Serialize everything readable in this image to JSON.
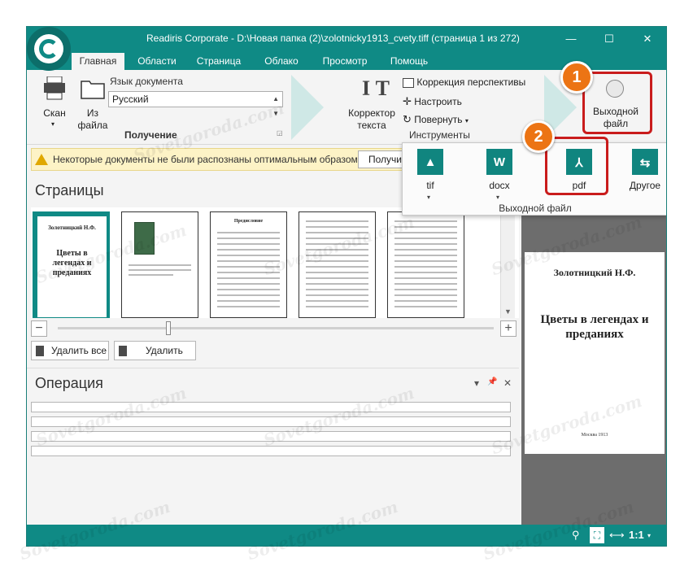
{
  "window": {
    "title": "Readiris Corporate - D:\\Новая папка (2)\\zolotnicky1913_cvety.tiff (страница 1 из 272)",
    "controls": {
      "minimize": "—",
      "maximize": "☐",
      "close": "✕"
    }
  },
  "tabs": [
    "Главная",
    "Области",
    "Страница",
    "Облако",
    "Просмотр",
    "Помощь"
  ],
  "ribbon": {
    "scan_label": "Скан",
    "from_file_label_1": "Из",
    "from_file_label_2": "файла",
    "doc_lang_label": "Язык документа",
    "doc_lang_value": "Русский",
    "group_acquire": "Получение",
    "text_corrector_1": "Корректор",
    "text_corrector_2": "текста",
    "perspective": "Коррекция перспективы",
    "adjust": "Настроить",
    "rotate": "Повернуть",
    "group_tools": "Инструменты",
    "output_file_1": "Выходной",
    "output_file_2": "файл"
  },
  "dropdown": {
    "formats": [
      {
        "name": "tif",
        "icon": "tif-image-icon",
        "glyph": "▲"
      },
      {
        "name": "docx",
        "icon": "word-icon",
        "glyph": "W"
      },
      {
        "name": "pdf",
        "icon": "pdf-icon",
        "glyph": "⅄"
      },
      {
        "name": "Другое",
        "icon": "swap-arrows-icon",
        "glyph": "⇆"
      }
    ],
    "group_label": "Выходной файл"
  },
  "badges": [
    "1",
    "2"
  ],
  "notification": {
    "text": "Некоторые документы не были распознаны оптимальным образом.",
    "button": "Получить"
  },
  "pages_panel": {
    "title": "Страницы",
    "delete_all": "Удалить все",
    "delete": "Удалить",
    "thumb1_author": "Золотницкий Н.Ф.",
    "thumb1_title": "Цветы в легендах и преданиях",
    "thumb3_heading": "Предисловие",
    "slider_level": 0.25
  },
  "operation_panel": {
    "title": "Операция",
    "controls": {
      "dropdown": "▾",
      "pin": "📌",
      "close": "✕"
    }
  },
  "preview": {
    "author": "Золотницкий Н.Ф.",
    "title": "Цветы в легендах и преданиях",
    "foot": "Москва 1913"
  },
  "statusbar": {
    "zoom_ratio": "1:1"
  },
  "watermark": "Sovetgoroda.com",
  "colors": {
    "accent": "#0f8a85",
    "badge": "#ec7414",
    "highlight_box": "#c91c1c",
    "notify_bg": "#fdf3c6"
  }
}
